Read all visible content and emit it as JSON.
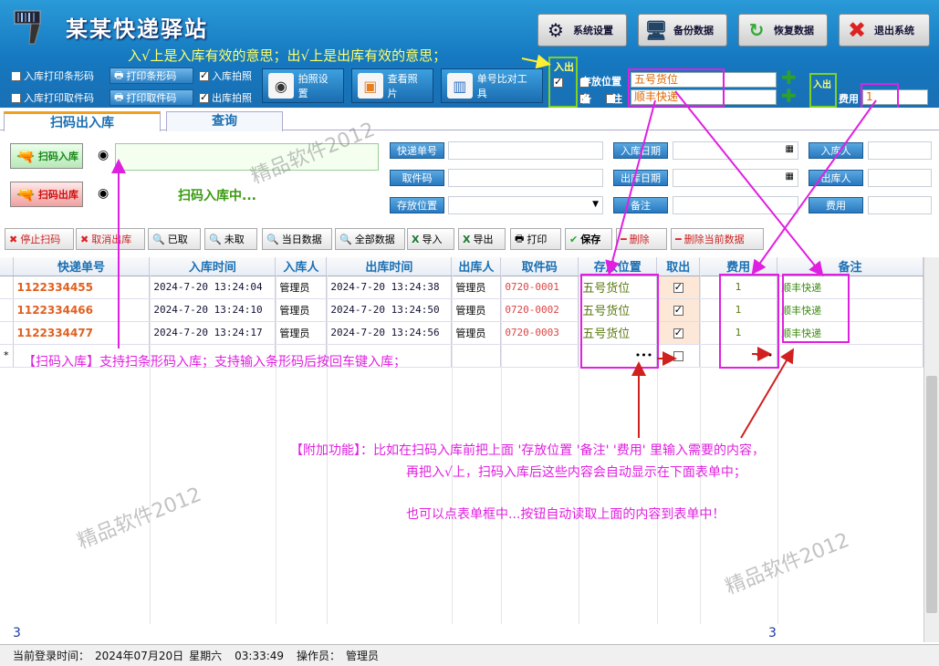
{
  "header": {
    "title": "某某快递驿站",
    "hint": "入√上是入库有效的意思；出√上是出库有效的意思；",
    "buttons": [
      {
        "label": "系统设置",
        "icon": "gear-icon"
      },
      {
        "label": "备份数据",
        "icon": "backup-icon"
      },
      {
        "label": "恢复数据",
        "icon": "restore-icon"
      },
      {
        "label": "退出系统",
        "icon": "close-icon"
      }
    ]
  },
  "options": {
    "print_barcode_in": "入库打印条形码",
    "print_pickup_in": "入库打印取件码",
    "print_barcode_btn": "打印条形码",
    "print_pickup_btn": "打印取件码",
    "photo_in": "入库拍照",
    "photo_out": "出库拍照",
    "photo_settings": "拍照设置",
    "view_photo": "查看照片",
    "compare_tool": "单号比对工具"
  },
  "defaults": {
    "in_out_label": "入出",
    "location_label": "存放位置",
    "location_value": "五号货位",
    "note_label": "备      注",
    "note_value": "顺丰快递",
    "fee_label": "费用",
    "fee_value": "1"
  },
  "tabs": [
    "扫码出入库",
    "查询"
  ],
  "scan": {
    "scan_in": "扫码入库",
    "scan_out": "扫码出库",
    "status": "扫码入库中..."
  },
  "filters": {
    "tracking_no": "快递单号",
    "pickup_code": "取件码",
    "location": "存放位置",
    "in_date": "入库日期",
    "out_date": "出库日期",
    "note": "备注",
    "in_person": "入库人",
    "out_person": "出库人",
    "fee": "费用"
  },
  "toolbar": [
    "停止扫码",
    "取消出库",
    "已取",
    "未取",
    "当日数据",
    "全部数据",
    "导入",
    "导出",
    "打印",
    "保存",
    "删除",
    "删除当前数据"
  ],
  "grid": {
    "columns": [
      "快递单号",
      "入库时间",
      "入库人",
      "出库时间",
      "出库人",
      "取件码",
      "存放位置",
      "取出",
      "费用",
      "备注"
    ],
    "rows": [
      {
        "no": "1122334455",
        "in_time": "2024-7-20  13:24:04",
        "in_person": "管理员",
        "out_time": "2024-7-20  13:24:38",
        "out_person": "管理员",
        "code": "0720-0001",
        "loc": "五号货位",
        "taken": true,
        "fee": "1",
        "note": "顺丰快递"
      },
      {
        "no": "1122334466",
        "in_time": "2024-7-20  13:24:10",
        "in_person": "管理员",
        "out_time": "2024-7-20  13:24:50",
        "out_person": "管理员",
        "code": "0720-0002",
        "loc": "五号货位",
        "taken": true,
        "fee": "1",
        "note": "顺丰快递"
      },
      {
        "no": "1122334477",
        "in_time": "2024-7-20  13:24:17",
        "in_person": "管理员",
        "out_time": "2024-7-20  13:24:56",
        "out_person": "管理员",
        "code": "0720-0003",
        "loc": "五号货位",
        "taken": true,
        "fee": "1",
        "note": "顺丰快递"
      }
    ],
    "new_row_marker": "*",
    "footer_count": "3",
    "footer_fee_sum": "3"
  },
  "annotations": {
    "scan_note": "【扫码入库】支持扫条形码入库；支持输入条形码后按回车键入库；",
    "extra_line1": "【附加功能】：比如在扫码入库前把上面 '存放位置 '备注' '费用' 里输入需要的内容，",
    "extra_line2": "再把入√上，扫码入库后这些内容会自动显示在下面表单中；",
    "extra_line3": "也可以点表单框中...按钮自动读取上面的内容到表单中！",
    "watermark": "精品软件2012"
  },
  "status": {
    "login_label": "当前登录时间：",
    "date": "2024年07月20日",
    "weekday": "星期六",
    "time": "03:33:49",
    "operator_label": "操作员：",
    "operator": "管理员"
  },
  "colors": {
    "header_blue": "#1a78c0",
    "annotation": "#e020e0",
    "highlight_green": "#7ed321"
  }
}
